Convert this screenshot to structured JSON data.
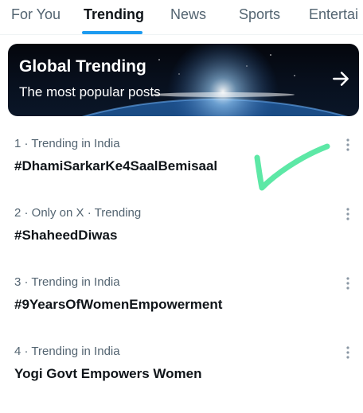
{
  "tabs": [
    {
      "label": "For You",
      "active": false
    },
    {
      "label": "Trending",
      "active": true
    },
    {
      "label": "News",
      "active": false
    },
    {
      "label": "Sports",
      "active": false
    },
    {
      "label": "Entertai",
      "active": false
    }
  ],
  "banner": {
    "title": "Global Trending",
    "subtitle": "The most popular posts",
    "arrow_icon": "arrow-right-icon"
  },
  "trends": [
    {
      "meta": "1 · Trending in India",
      "name": "#DhamiSarkarKe4SaalBemisaal"
    },
    {
      "meta": "2 · Only on X · Trending",
      "name": "#ShaheedDiwas"
    },
    {
      "meta": "3 · Trending in India",
      "name": "#9YearsOfWomenEmpowerment"
    },
    {
      "meta": "4 · Trending in India",
      "name": "Yogi Govt Empowers Women"
    }
  ],
  "more_icon": "more-vertical-icon",
  "annotation": {
    "icon": "checkmark-annotation-icon",
    "color": "#5de8a6"
  },
  "colors": {
    "accent": "#1d9bf0",
    "text": "#0f1419",
    "secondary": "#536471"
  }
}
